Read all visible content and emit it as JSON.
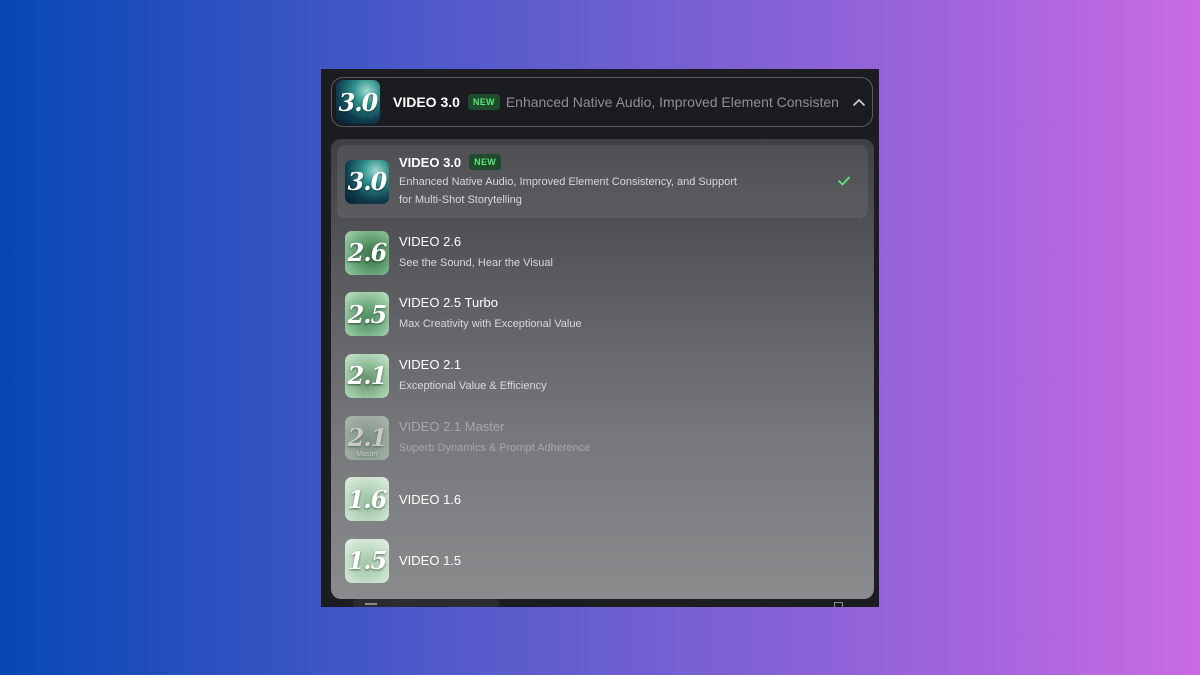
{
  "selected": {
    "title": "VIDEO 3.0",
    "badge": "NEW",
    "description": "Enhanced Native Audio, Improved Element Consistency, …",
    "thumb_label": "3.0"
  },
  "models": [
    {
      "title": "VIDEO 3.0",
      "badge": "NEW",
      "thumb_label": "3.0",
      "desc_line1": "Enhanced Native Audio, Improved Element Consistency, and Support",
      "desc_line2": "for Multi-Shot Storytelling",
      "selected": true
    },
    {
      "title": "VIDEO 2.6",
      "thumb_label": "2.6",
      "description": "See the Sound, Hear the Visual"
    },
    {
      "title": "VIDEO 2.5 Turbo",
      "thumb_label": "2.5",
      "description": "Max Creativity with Exceptional Value"
    },
    {
      "title": "VIDEO 2.1",
      "thumb_label": "2.1",
      "description": "Exceptional Value & Efficiency"
    },
    {
      "title": "VIDEO 2.1 Master",
      "thumb_label": "2.1",
      "thumb_sub": "Master",
      "description": "Superb Dynamics & Prompt Adherence",
      "disabled": true
    },
    {
      "title": "VIDEO 1.6",
      "thumb_label": "1.6"
    },
    {
      "title": "VIDEO 1.5",
      "thumb_label": "1.5"
    }
  ],
  "colors": {
    "badge_text": "#5fe37a",
    "badge_bg": "#1f4a2c",
    "check": "#5fe37a"
  },
  "icons": {
    "selector_chevron": "chevron-up-icon",
    "selected_mark": "check-icon"
  }
}
